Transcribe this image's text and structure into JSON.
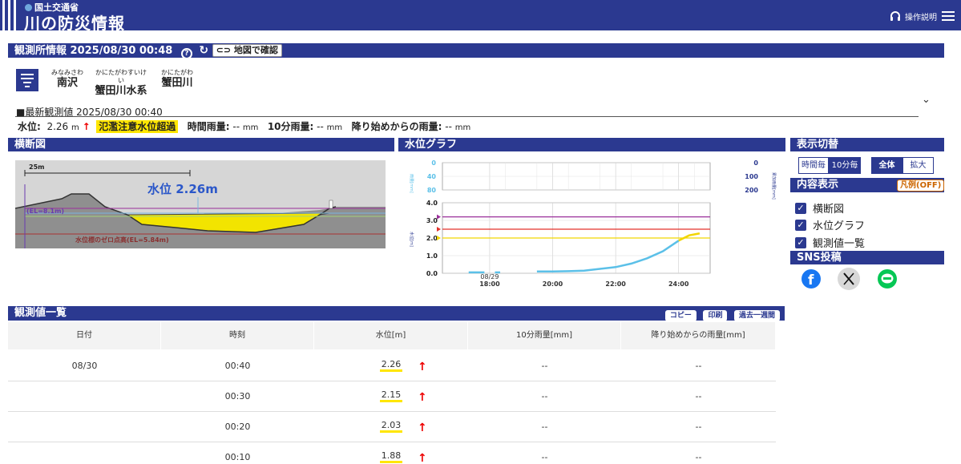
{
  "header": {
    "agency": "国土交通省",
    "site_title": "川の防災情報",
    "help_label": "操作説明",
    "help_icon": "headphones-icon",
    "menu_icon": "hamburger-menu-icon"
  },
  "station_bar": {
    "title": "観測所情報 2025/08/30 00:48",
    "map_button": "地図で確認"
  },
  "station": {
    "name_ruby": "みなみさわ",
    "name": "南沢",
    "system_ruby": "かにたがわすいけい",
    "system": "蟹田川水系",
    "river_ruby": "かにたがわ",
    "river": "蟹田川"
  },
  "latest": {
    "label": "■最新観測値",
    "time": "2025/08/30 00:40",
    "level_label": "水位:",
    "level_value": "2.26",
    "level_unit": "m",
    "level_arrow": "↑",
    "warning": "氾濫注意水位超過",
    "hourly_label": "時間雨量:",
    "hourly_value": "--",
    "tenmin_label": "10分雨量:",
    "tenmin_value": "--",
    "cumul_label": "降り始めからの雨量:",
    "cumul_value": "--",
    "rain_unit": "mm"
  },
  "cross_section": {
    "title": "横断図",
    "scale": "25m",
    "level_text": "水位 2.26m",
    "el_label": "(EL=8.1m)",
    "zero_label": "水位標のゼロ点高(EL=5.84m)"
  },
  "graph": {
    "title": "水位グラフ",
    "left_rain_axis": [
      "0",
      "40",
      "80"
    ],
    "right_rain_axis": [
      "0",
      "100",
      "200"
    ],
    "left_rain_label": "雨量[mm]",
    "right_rain_label": "累加雨量[mm]",
    "level_axis_label": "水位[m]",
    "level_ticks": [
      "4.0",
      "3.0",
      "2.0",
      "1.0",
      "0.0"
    ],
    "x_ticks": [
      "08/29\n18:00",
      "20:00",
      "22:00",
      "24:00"
    ]
  },
  "chart_data": {
    "type": "line",
    "ylabel": "水位[m]",
    "ylim": [
      0,
      4
    ],
    "x_ticks": [
      "08/29 18:00",
      "20:00",
      "22:00",
      "24:00"
    ],
    "thresholds": [
      {
        "color": "#9b2f9b",
        "value": 3.2
      },
      {
        "color": "#e3312b",
        "value": 2.5
      },
      {
        "color": "#f2d600",
        "value": 2.0
      }
    ],
    "series": [
      {
        "color": "#5bc0e8",
        "points": [
          [
            "17:20",
            0.05
          ],
          [
            "17:50",
            0.05
          ],
          [
            "18:10",
            0.05
          ],
          [
            "18:20",
            0.05
          ],
          [
            "19:30",
            0.1
          ],
          [
            "20:00",
            0.1
          ],
          [
            "20:30",
            0.12
          ],
          [
            "21:00",
            0.15
          ],
          [
            "21:30",
            0.25
          ],
          [
            "22:00",
            0.35
          ],
          [
            "22:30",
            0.55
          ],
          [
            "23:00",
            0.85
          ],
          [
            "23:30",
            1.25
          ],
          [
            "24:00",
            1.85
          ],
          [
            "24:20",
            2.15
          ],
          [
            "24:40",
            2.26
          ]
        ]
      }
    ]
  },
  "display_switch": {
    "title": "表示切替",
    "interval_options": [
      "時間毎",
      "10分毎"
    ],
    "interval_selected": "10分毎",
    "zoom_options": [
      "全体",
      "拡大"
    ],
    "zoom_selected": "全体"
  },
  "content_display": {
    "title": "内容表示",
    "legend_button": "凡例(OFF)",
    "items": [
      "横断図",
      "水位グラフ",
      "観測値一覧"
    ]
  },
  "sns": {
    "title": "SNS投稿",
    "icons": [
      "facebook-icon",
      "x-icon",
      "line-icon"
    ]
  },
  "table": {
    "title": "観測値一覧",
    "buttons": [
      "コピー",
      "印刷",
      "過去一週間"
    ],
    "headers": [
      "日付",
      "時刻",
      "水位[m]",
      "10分雨量[mm]",
      "降り始めからの雨量[mm]"
    ],
    "rows": [
      {
        "date": "08/30",
        "time": "00:40",
        "level": "2.26",
        "tenmin": "--",
        "cumul": "--"
      },
      {
        "date": "",
        "time": "00:30",
        "level": "2.15",
        "tenmin": "--",
        "cumul": "--"
      },
      {
        "date": "",
        "time": "00:20",
        "level": "2.03",
        "tenmin": "--",
        "cumul": "--"
      },
      {
        "date": "",
        "time": "00:10",
        "level": "1.88",
        "tenmin": "--",
        "cumul": "--"
      }
    ]
  },
  "colors": {
    "brand": "#2b3990",
    "warning": "#ffe600",
    "water": "#f2e400",
    "level_line": "#5bc0e8"
  }
}
